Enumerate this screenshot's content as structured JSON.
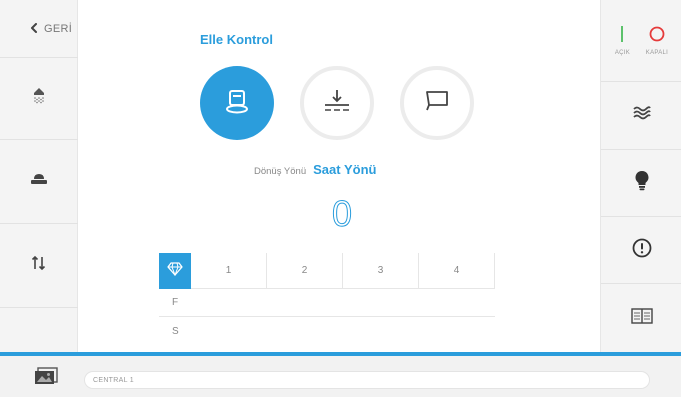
{
  "header": {
    "back_label": "GERİ",
    "mode_title": "Elle Kontrol"
  },
  "power": {
    "on_label": "AÇIK",
    "off_label": "KAPALI",
    "on_color": "#5cc16b",
    "off_color": "#e53a3a"
  },
  "left_sidebar": {
    "items": [
      {
        "icon": "shower-icon"
      },
      {
        "icon": "seat-icon"
      },
      {
        "icon": "up-down-arrows-icon"
      }
    ]
  },
  "right_sidebar": {
    "items": [
      {
        "icon": "waves-icon"
      },
      {
        "icon": "lightbulb-icon"
      },
      {
        "icon": "alert-icon"
      },
      {
        "icon": "book-icon"
      }
    ]
  },
  "modes": [
    {
      "icon": "seat-basin-icon",
      "active": true
    },
    {
      "icon": "download-icon",
      "active": false
    },
    {
      "icon": "display-icon",
      "active": false
    }
  ],
  "direction": {
    "label": "Dönüş Yönü",
    "value": "Saat Yönü",
    "value_display": "0"
  },
  "grid": {
    "columns": [
      "1",
      "2",
      "3",
      "4"
    ],
    "rows": [
      "F",
      "S"
    ]
  },
  "footer": {
    "field_text": "CENTRAL 1"
  },
  "colors": {
    "accent": "#2b9ddc"
  }
}
